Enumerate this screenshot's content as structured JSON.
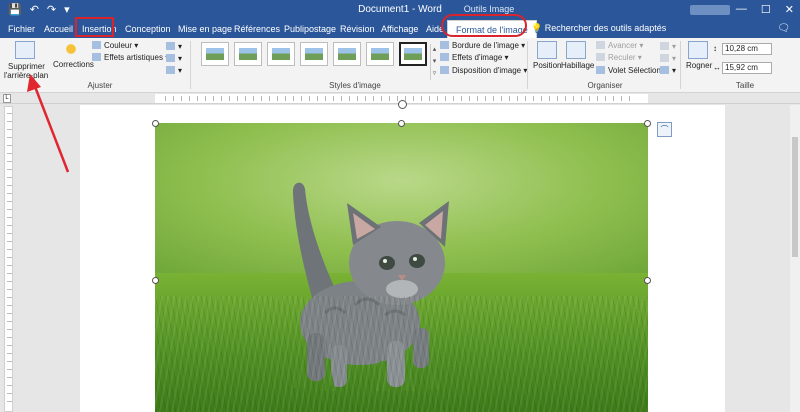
{
  "titlebar": {
    "title": "Document1 - Word",
    "contextual_group": "Outils Image",
    "qat": {
      "save": "💾",
      "undo": "↶",
      "redo": "↷",
      "customize": "▾"
    },
    "window": {
      "minimize": "—",
      "maximize": "☐",
      "close": "✕"
    }
  },
  "tabs": [
    {
      "label": "Fichier"
    },
    {
      "label": "Accueil"
    },
    {
      "label": "Insertion"
    },
    {
      "label": "Conception"
    },
    {
      "label": "Mise en page"
    },
    {
      "label": "Références"
    },
    {
      "label": "Publipostage"
    },
    {
      "label": "Révision"
    },
    {
      "label": "Affichage"
    },
    {
      "label": "Aide"
    },
    {
      "label": "Format de l'image"
    }
  ],
  "tellme": {
    "icon": "💡",
    "label": "Rechercher des outils adaptés"
  },
  "share_icon": "🗨",
  "ribbon": {
    "remove_bg": {
      "line1": "Supprimer",
      "line2": "l'arrière-plan"
    },
    "corrections": "Corrections",
    "color": "Couleur",
    "artistic": "Effets artistiques",
    "adjust_label": "Ajuster",
    "styles_label": "Styles d'image",
    "border": "Bordure de l'image",
    "effects": "Effets d'image",
    "layout": "Disposition d'image",
    "position": "Position",
    "wrap": "Habillage",
    "forward": "Avancer",
    "backward": "Reculer",
    "selection": "Volet Sélection",
    "arrange_label": "Organiser",
    "crop": "Rogner",
    "height": "10,28 cm",
    "width": "15,92 cm",
    "size_label": "Taille"
  },
  "ruler_corner": "L",
  "layout_options_icon": "⌒"
}
